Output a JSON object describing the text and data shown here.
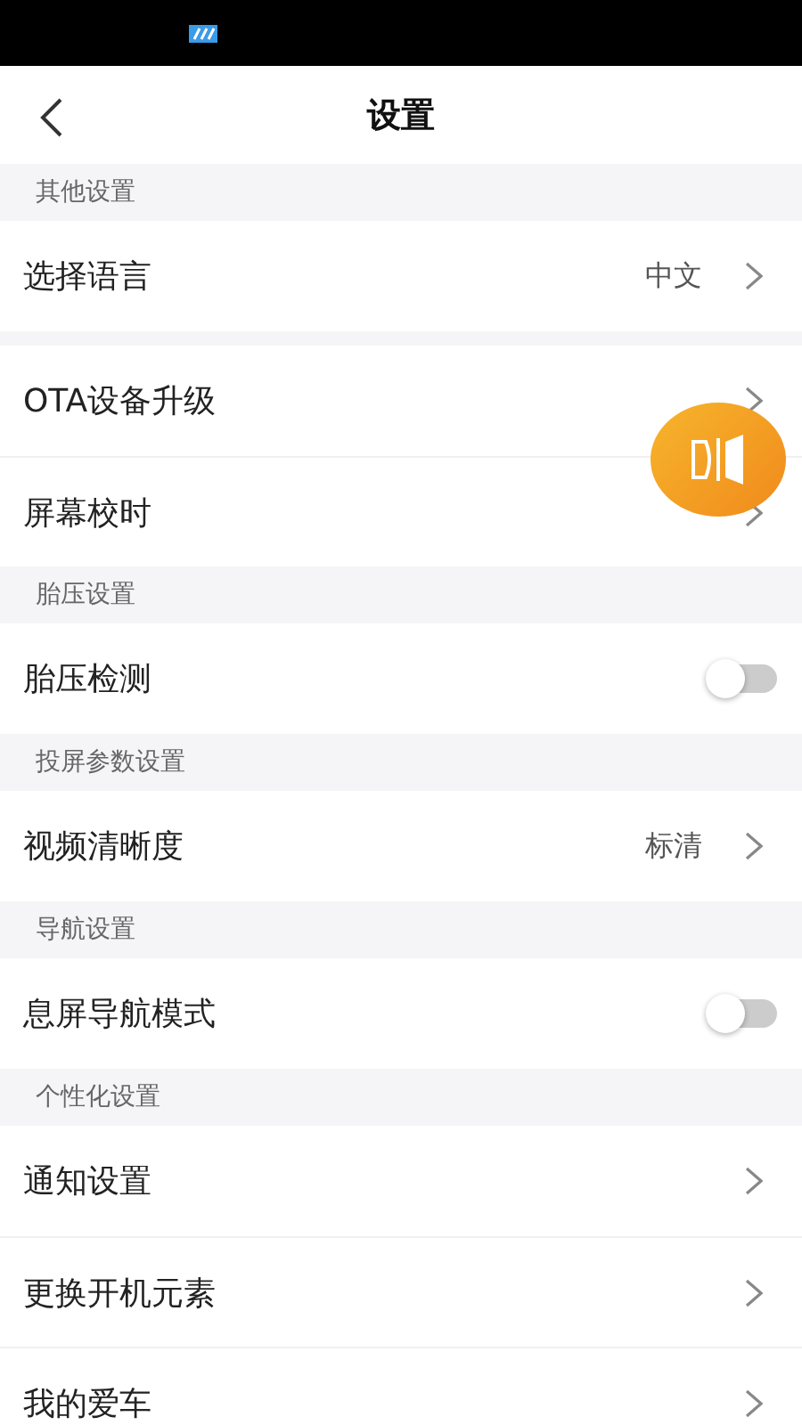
{
  "header": {
    "title": "设置"
  },
  "sections": [
    {
      "title": "其他设置",
      "rows": [
        {
          "kind": "link",
          "label": "选择语言",
          "value": "中文"
        }
      ]
    },
    {
      "rows": [
        {
          "kind": "link",
          "label": "OTA设备升级"
        },
        {
          "kind": "link",
          "label": "屏幕校时"
        }
      ]
    },
    {
      "title": "胎压设置",
      "rows": [
        {
          "kind": "toggle",
          "label": "胎压检测",
          "on": false
        }
      ]
    },
    {
      "title": "投屏参数设置",
      "rows": [
        {
          "kind": "link",
          "label": "视频清晰度",
          "value": "标清"
        }
      ]
    },
    {
      "title": "导航设置",
      "rows": [
        {
          "kind": "toggle",
          "label": "息屏导航模式",
          "on": false
        }
      ]
    },
    {
      "title": "个性化设置",
      "rows": [
        {
          "kind": "link",
          "label": "通知设置"
        },
        {
          "kind": "link",
          "label": "更换开机元素"
        },
        {
          "kind": "link",
          "label": "我的爱车"
        }
      ]
    }
  ]
}
